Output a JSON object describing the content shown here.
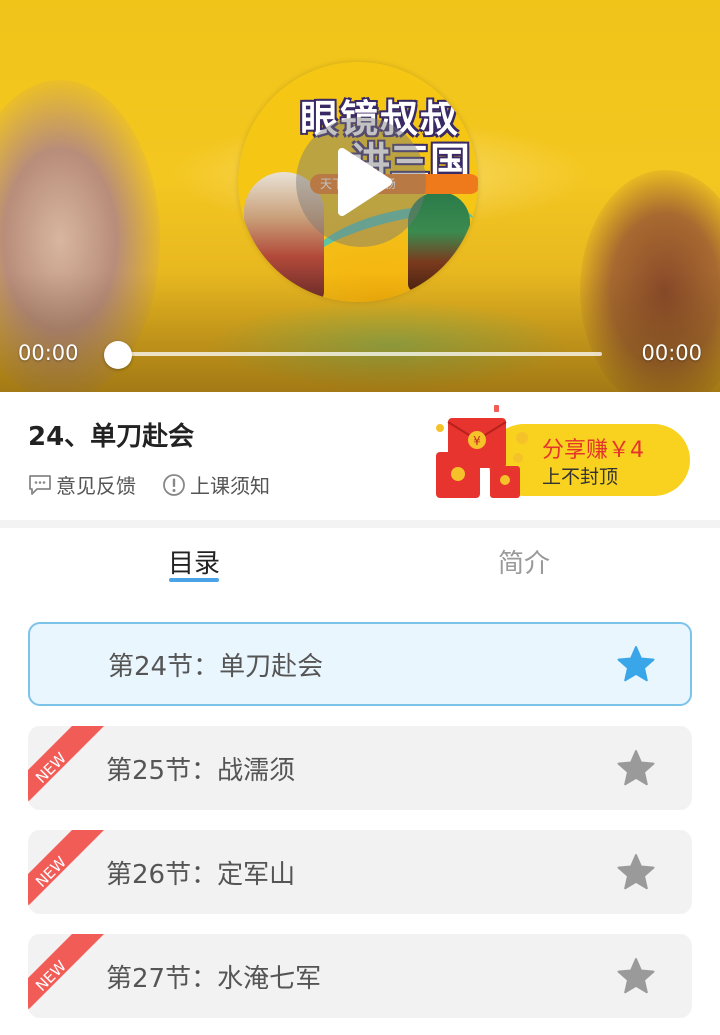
{
  "player": {
    "current_time": "00:00",
    "total_time": "00:00",
    "progress": 0,
    "cover_title_line1": "眼镜叔叔",
    "cover_title_line2": "讲三国",
    "cover_ribbon": "天下 荡气回肠"
  },
  "lesson": {
    "title": "24、单刀赴会",
    "feedback_label": "意见反馈",
    "notice_label": "上课须知"
  },
  "share": {
    "main_label": "分享赚￥4",
    "sub_label": "上不封顶"
  },
  "tabs": [
    {
      "label": "目录",
      "active": true
    },
    {
      "label": "简介",
      "active": false
    }
  ],
  "chapters": [
    {
      "label": "第24节：单刀赴会",
      "active": true,
      "new": false,
      "star_color": "#3aa6ea"
    },
    {
      "label": "第25节：战濡须",
      "active": false,
      "new": true,
      "star_color": "#999999"
    },
    {
      "label": "第26节：定军山",
      "active": false,
      "new": true,
      "star_color": "#999999"
    },
    {
      "label": "第27节：水淹七军",
      "active": false,
      "new": true,
      "star_color": "#999999"
    }
  ],
  "new_tag_text": "NEW",
  "colors": {
    "accent": "#4aa3e6",
    "new_tag": "#f25c57",
    "share_pill": "#f8d21f",
    "share_text": "#e3352b"
  },
  "icons": {
    "play": "play-icon",
    "feedback": "chat-bubble-icon",
    "notice": "exclamation-circle-icon",
    "star": "star-icon",
    "red_envelope": "red-envelope-icon"
  }
}
